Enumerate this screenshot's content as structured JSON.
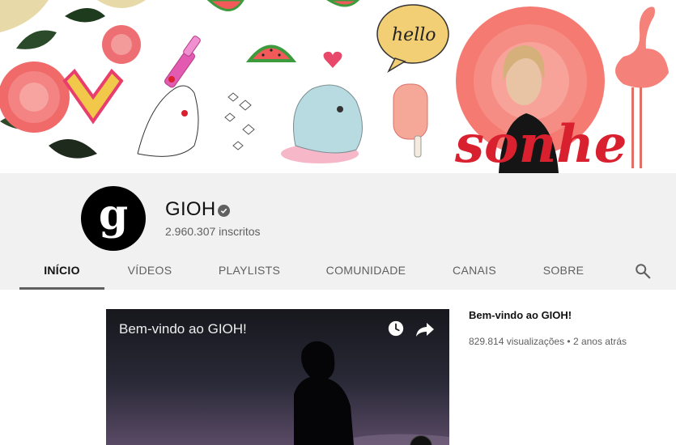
{
  "colors": {
    "header_bg": "#f1f1f1",
    "accent_red": "#d9202f",
    "text_primary": "#111111",
    "text_secondary": "#606060"
  },
  "banner": {
    "hello_text": "hello",
    "sonhe_text": "sonhe"
  },
  "channel": {
    "avatar_letter": "g",
    "name": "GIOH",
    "verified_icon": "check-circle-icon",
    "subscribers": "2.960.307 inscritos"
  },
  "tabs": [
    {
      "label": "INÍCIO",
      "active": true
    },
    {
      "label": "VÍDEOS",
      "active": false
    },
    {
      "label": "PLAYLISTS",
      "active": false
    },
    {
      "label": "COMUNIDADE",
      "active": false
    },
    {
      "label": "CANAIS",
      "active": false
    },
    {
      "label": "SOBRE",
      "active": false
    }
  ],
  "search_icon": "search-icon",
  "featured": {
    "player_title": "Bem-vindo ao GIOH!",
    "title": "Bem-vindo ao GIOH!",
    "meta": "829.814 visualizações • 2 anos atrás",
    "icons": [
      "clock-icon",
      "share-icon"
    ]
  }
}
